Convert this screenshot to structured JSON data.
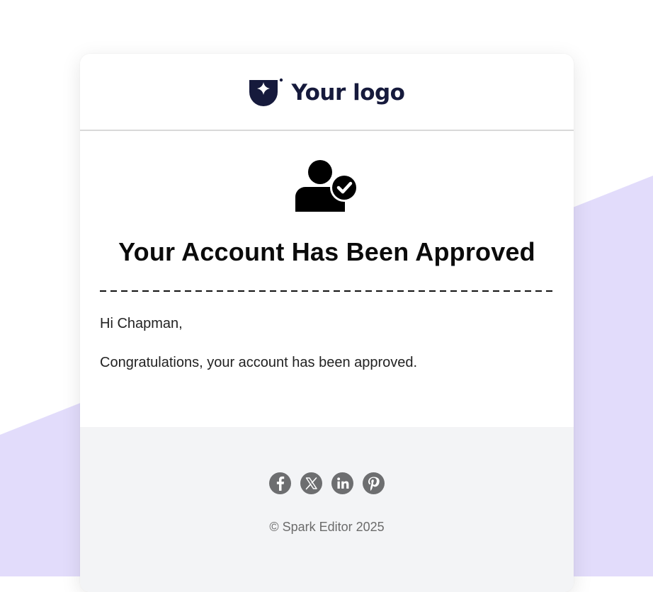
{
  "colors": {
    "background_accent": "#e2dcfb",
    "card_background": "#ffffff",
    "footer_background": "#f3f4f6",
    "logo_color": "#161a3c",
    "title_color": "#0b0b0b",
    "social_icon_color": "#6d6e70"
  },
  "header": {
    "logo_icon": "shield-star-icon",
    "logo_text": "Your logo"
  },
  "body": {
    "hero_icon": "user-check-icon",
    "title": "Your Account Has Been Approved",
    "greeting": "Hi Chapman,",
    "message": "Congratulations, your account has been approved."
  },
  "footer": {
    "social_links": [
      {
        "name": "facebook",
        "icon": "facebook-icon"
      },
      {
        "name": "x",
        "icon": "x-icon"
      },
      {
        "name": "linkedin",
        "icon": "linkedin-icon"
      },
      {
        "name": "pinterest",
        "icon": "pinterest-icon"
      }
    ],
    "copyright": "© Spark Editor 2025"
  }
}
